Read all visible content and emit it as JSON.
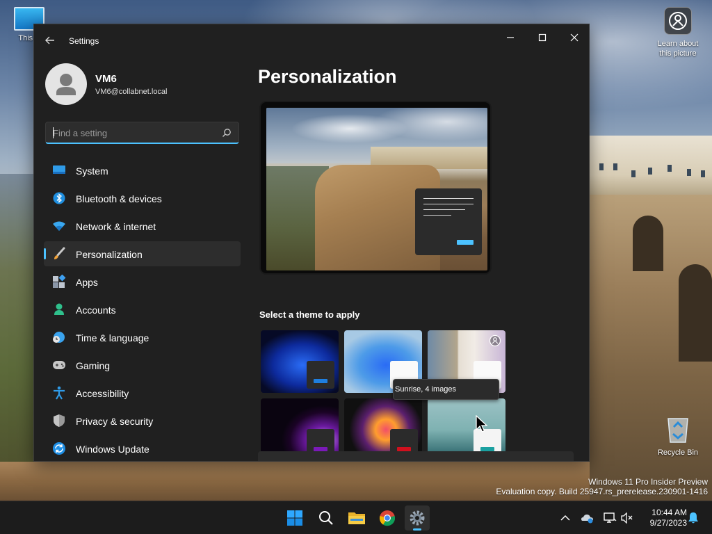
{
  "desktop": {
    "icons": {
      "this_pc_label": "This P",
      "learn_label": "Learn about this picture",
      "recycle_label": "Recycle Bin"
    },
    "watermark": {
      "line1": "Windows 11 Pro Insider Preview",
      "line2": "Evaluation copy. Build 25947.rs_prerelease.230901-1416"
    }
  },
  "window": {
    "title": "Settings",
    "controls": {
      "minimize": "minimize-icon",
      "maximize": "maximize-icon",
      "close": "close-icon"
    }
  },
  "profile": {
    "name": "VM6",
    "email": "VM6@collabnet.local"
  },
  "search": {
    "placeholder": "Find a setting",
    "value": ""
  },
  "sidebar": {
    "items": [
      {
        "label": "System",
        "icon": "system-icon",
        "active": false
      },
      {
        "label": "Bluetooth & devices",
        "icon": "bluetooth-icon",
        "active": false
      },
      {
        "label": "Network & internet",
        "icon": "wifi-icon",
        "active": false
      },
      {
        "label": "Personalization",
        "icon": "brush-icon",
        "active": true
      },
      {
        "label": "Apps",
        "icon": "apps-icon",
        "active": false
      },
      {
        "label": "Accounts",
        "icon": "accounts-icon",
        "active": false
      },
      {
        "label": "Time & language",
        "icon": "clock-globe-icon",
        "active": false
      },
      {
        "label": "Gaming",
        "icon": "gamepad-icon",
        "active": false
      },
      {
        "label": "Accessibility",
        "icon": "accessibility-icon",
        "active": false
      },
      {
        "label": "Privacy & security",
        "icon": "shield-icon",
        "active": false
      },
      {
        "label": "Windows Update",
        "icon": "update-icon",
        "active": false
      }
    ]
  },
  "main": {
    "title": "Personalization",
    "theme_heading": "Select a theme to apply",
    "themes": [
      {
        "name": "windows-dark-theme"
      },
      {
        "name": "windows-light-theme"
      },
      {
        "name": "windows-spotlight-theme"
      },
      {
        "name": "glow-theme"
      },
      {
        "name": "captured-motion-theme"
      },
      {
        "name": "sunrise-theme"
      }
    ],
    "tooltip": "Sunrise, 4 images"
  },
  "taskbar": {
    "apps": [
      "start-icon",
      "search-icon",
      "file-explorer-icon",
      "chrome-icon",
      "settings-icon"
    ],
    "tray": [
      "chevron-up-icon",
      "onedrive-icon",
      "network-icon",
      "volume-muted-icon"
    ],
    "time": "10:44 AM",
    "date": "9/27/2023"
  },
  "colors": {
    "accent": "#4cc2ff",
    "window_bg": "#202020",
    "panel_bg": "#2d2d2d"
  }
}
